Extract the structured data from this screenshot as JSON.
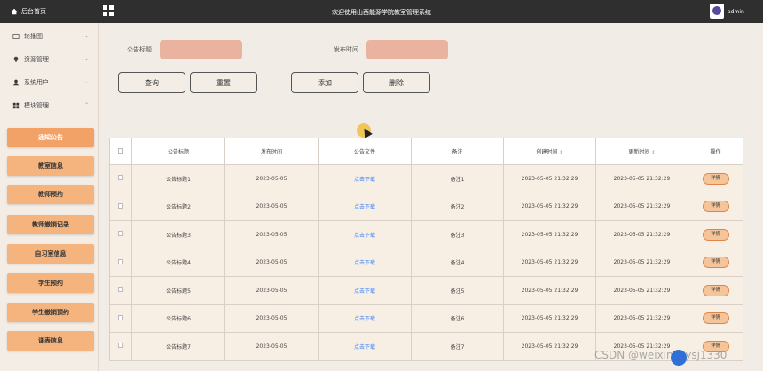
{
  "topbar": {
    "home_label": "后台首页",
    "title": "欢迎使用山西能源学院教室管理系统",
    "user": "admin"
  },
  "sidebar": {
    "menus": [
      {
        "label": "轮播图",
        "icon": "image-icon",
        "chevron": "⌄"
      },
      {
        "label": "资源管理",
        "icon": "location-icon",
        "chevron": "⌄"
      },
      {
        "label": "系统用户",
        "icon": "user-icon",
        "chevron": "⌄"
      },
      {
        "label": "模块管理",
        "icon": "grid-icon",
        "chevron": "⌃"
      }
    ],
    "submenus": [
      "通知公告",
      "教室信息",
      "教师预约",
      "教师撤销记录",
      "自习室信息",
      "学生预约",
      "学生撤销预约",
      "课表信息"
    ]
  },
  "search": {
    "title_label": "公告标题",
    "time_label": "发布时间",
    "title_value": "",
    "time_value": ""
  },
  "buttons": {
    "query": "查询",
    "reset": "重置",
    "add": "添加",
    "delete": "删除"
  },
  "table": {
    "headers": [
      "公告标题",
      "发布时间",
      "公告文件",
      "备注",
      "创建时间",
      "更新时间",
      "操作"
    ],
    "sort_mark": "⇕",
    "rows": [
      {
        "title": "公告标题1",
        "pub": "2023-05-05",
        "file": "点击下载",
        "note": "备注1",
        "created": "2023-05-05 21:32:29",
        "updated": "2023-05-05 21:32:29",
        "action": "详情"
      },
      {
        "title": "公告标题2",
        "pub": "2023-05-05",
        "file": "点击下载",
        "note": "备注2",
        "created": "2023-05-05 21:32:29",
        "updated": "2023-05-05 21:32:29",
        "action": "详情"
      },
      {
        "title": "公告标题3",
        "pub": "2023-05-05",
        "file": "点击下载",
        "note": "备注3",
        "created": "2023-05-05 21:32:29",
        "updated": "2023-05-05 21:32:29",
        "action": "详情"
      },
      {
        "title": "公告标题4",
        "pub": "2023-05-05",
        "file": "点击下载",
        "note": "备注4",
        "created": "2023-05-05 21:32:29",
        "updated": "2023-05-05 21:32:29",
        "action": "详情"
      },
      {
        "title": "公告标题5",
        "pub": "2023-05-05",
        "file": "点击下载",
        "note": "备注5",
        "created": "2023-05-05 21:32:29",
        "updated": "2023-05-05 21:32:29",
        "action": "详情"
      },
      {
        "title": "公告标题6",
        "pub": "2023-05-05",
        "file": "点击下载",
        "note": "备注6",
        "created": "2023-05-05 21:32:29",
        "updated": "2023-05-05 21:32:29",
        "action": "详情"
      },
      {
        "title": "公告标题7",
        "pub": "2023-05-05",
        "file": "点击下载",
        "note": "备注7",
        "created": "2023-05-05 21:32:29",
        "updated": "2023-05-05 21:32:29",
        "action": "详情"
      }
    ]
  },
  "watermark": "CSDN @weixin_bysj1330",
  "colors": {
    "topbar": "#2f2f2f",
    "accent": "#f5b47e",
    "input": "#eab3a0",
    "row": "#f8efe4",
    "link": "#3b82f6"
  }
}
